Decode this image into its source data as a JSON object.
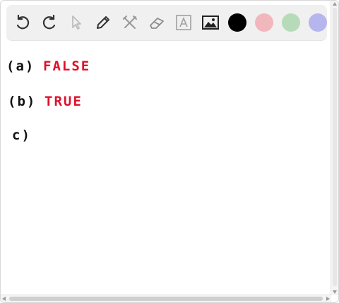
{
  "toolbar": {
    "tools": [
      "undo-icon",
      "redo-icon",
      "select-pointer-icon",
      "pen-icon",
      "tools-icon",
      "eraser-icon",
      "text-icon",
      "image-icon"
    ],
    "colors": {
      "black": "#000000",
      "red": "#f2b6bd",
      "green": "#b7dbb8",
      "blue": "#b7b5ee"
    }
  },
  "canvas": {
    "lines": [
      {
        "label": "(a)",
        "answer": "FALSE"
      },
      {
        "label": "(b)",
        "answer": "TRUE"
      },
      {
        "label": "c)",
        "answer": ""
      }
    ]
  }
}
